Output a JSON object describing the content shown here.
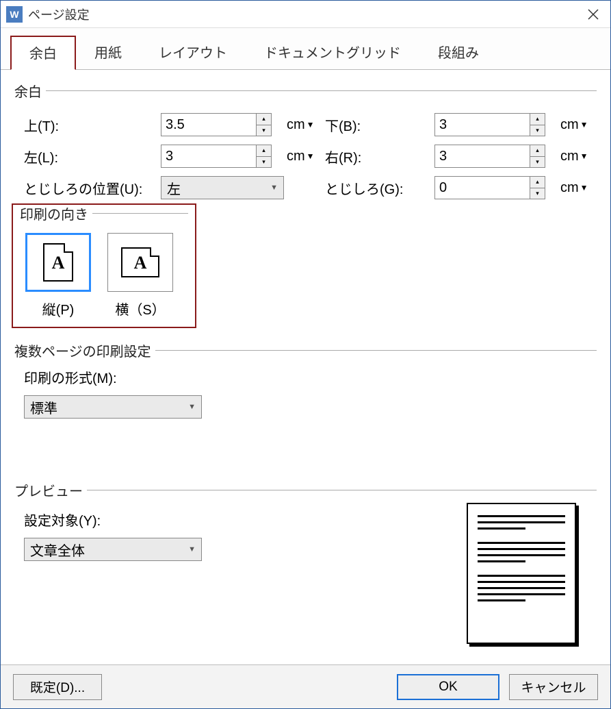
{
  "window": {
    "title": "ページ設定"
  },
  "tabs": {
    "margins": "余白",
    "paper": "用紙",
    "layout": "レイアウト",
    "grid": "ドキュメントグリッド",
    "columns": "段組み"
  },
  "margins": {
    "group": "余白",
    "top_label": "上(T):",
    "top_value": "3.5",
    "bottom_label": "下(B):",
    "bottom_value": "3",
    "left_label": "左(L):",
    "left_value": "3",
    "right_label": "右(R):",
    "right_value": "3",
    "gutter_pos_label": "とじしろの位置(U):",
    "gutter_pos_value": "左",
    "gutter_label": "とじしろ(G):",
    "gutter_value": "0",
    "unit": "cm"
  },
  "orientation": {
    "group": "印刷の向き",
    "portrait": "縦(P)",
    "landscape": "横（S）",
    "glyph": "A"
  },
  "multipage": {
    "group": "複数ページの印刷設定",
    "format_label": "印刷の形式(M):",
    "format_value": "標準"
  },
  "preview": {
    "group": "プレビュー",
    "apply_label": "設定対象(Y):",
    "apply_value": "文章全体"
  },
  "footer": {
    "default": "既定(D)...",
    "ok": "OK",
    "cancel": "キャンセル"
  }
}
